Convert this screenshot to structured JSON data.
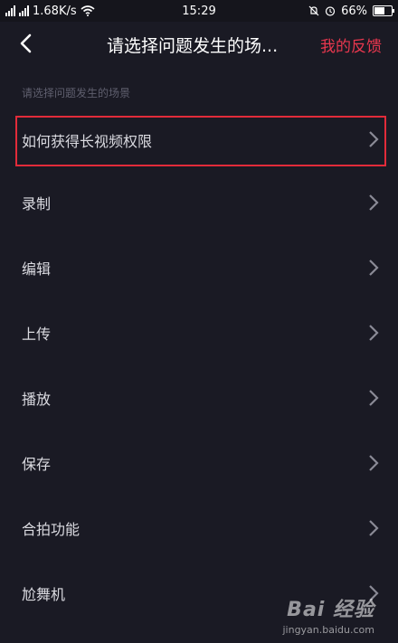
{
  "status_bar": {
    "network_left": "4G",
    "speed": "1.68K/s",
    "time": "15:29",
    "battery": "66%",
    "battery_level": 0.66
  },
  "nav": {
    "title": "请选择问题发生的场...",
    "action": "我的反馈"
  },
  "section_hint": "请选择问题发生的场景",
  "items": [
    {
      "label": "如何获得长视频权限"
    },
    {
      "label": "录制"
    },
    {
      "label": "编辑"
    },
    {
      "label": "上传"
    },
    {
      "label": "播放"
    },
    {
      "label": "保存"
    },
    {
      "label": "合拍功能"
    },
    {
      "label": "尬舞机"
    }
  ],
  "watermark": {
    "logo": "Bai 经验",
    "url": "jingyan.baidu.com"
  },
  "colors": {
    "background": "#1a1a24",
    "accent": "#e8374e",
    "highlight_border": "#e22b3a"
  }
}
